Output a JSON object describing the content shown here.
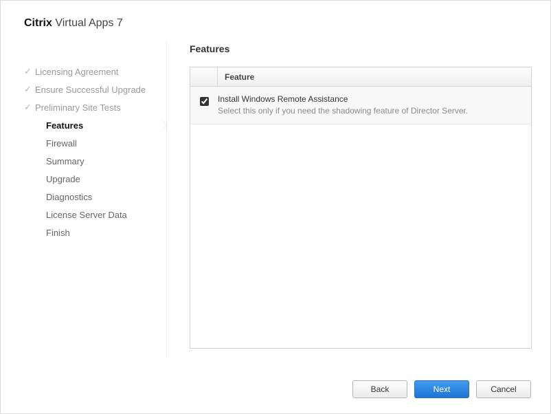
{
  "title": {
    "brand": "Citrix",
    "product": "Virtual Apps 7"
  },
  "heading": "Features",
  "sidebar": {
    "items": [
      {
        "label": "Licensing Agreement",
        "state": "completed"
      },
      {
        "label": "Ensure Successful Upgrade",
        "state": "completed"
      },
      {
        "label": "Preliminary Site Tests",
        "state": "completed"
      },
      {
        "label": "Features",
        "state": "current"
      },
      {
        "label": "Firewall",
        "state": "pending"
      },
      {
        "label": "Summary",
        "state": "pending"
      },
      {
        "label": "Upgrade",
        "state": "pending"
      },
      {
        "label": "Diagnostics",
        "state": "pending"
      },
      {
        "label": "License Server Data",
        "state": "pending"
      },
      {
        "label": "Finish",
        "state": "pending"
      }
    ]
  },
  "table": {
    "columns": {
      "feature": "Feature"
    },
    "rows": [
      {
        "checked": true,
        "title": "Install Windows Remote Assistance",
        "desc": "Select this only if you need the shadowing feature of Director Server."
      }
    ]
  },
  "buttons": {
    "back": "Back",
    "next": "Next",
    "cancel": "Cancel"
  }
}
